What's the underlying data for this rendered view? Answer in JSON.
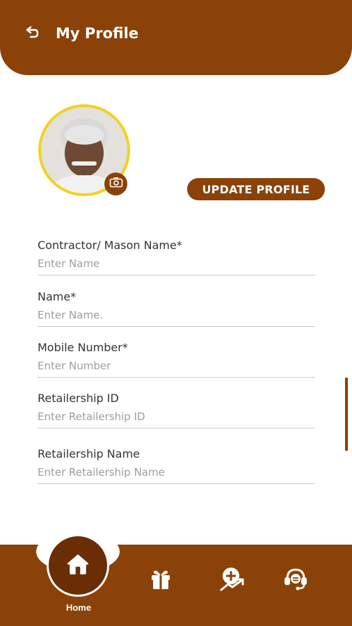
{
  "header": {
    "title": "My Profile",
    "back_icon": "back-arrow-icon"
  },
  "profile": {
    "update_button": "UPDATE PROFILE",
    "camera_icon": "camera-icon"
  },
  "form": {
    "fields": [
      {
        "label": "Contractor/ Mason Name*",
        "placeholder": "Enter Name",
        "value": ""
      },
      {
        "label": "Name*",
        "placeholder": "Enter Name.",
        "value": ""
      },
      {
        "label": "Mobile Number*",
        "placeholder": "Enter Number",
        "value": ""
      },
      {
        "label": "Retailership ID",
        "placeholder": "Enter Retailership ID",
        "value": ""
      },
      {
        "label": "Retailership Name",
        "placeholder": "Enter Retailership Name",
        "value": ""
      }
    ]
  },
  "bottom_nav": {
    "items": [
      {
        "label": "Home",
        "icon": "home-icon",
        "active": true
      },
      {
        "icon": "gift-icon"
      },
      {
        "icon": "add-growth-icon"
      },
      {
        "icon": "support-headset-icon"
      }
    ]
  },
  "colors": {
    "primary": "#8a4209",
    "avatar_border": "#f3d21c"
  }
}
